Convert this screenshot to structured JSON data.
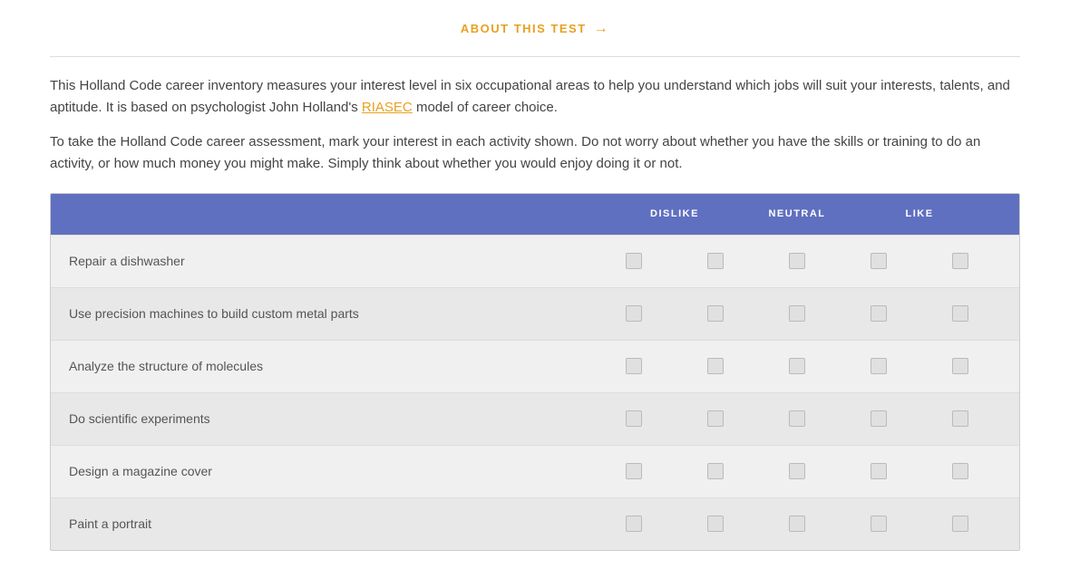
{
  "header": {
    "about_link": "ABOUT THIS TEST",
    "arrow": "→"
  },
  "intro": {
    "paragraph1": "This Holland Code career inventory measures your interest level in six occupational areas to help you understand which jobs will suit your interests, talents, and aptitude. It is based on psychologist John Holland's",
    "riasec_text": "RIASEC",
    "paragraph1_end": "model of career choice.",
    "paragraph2": "To take the Holland Code career assessment, mark your interest in each activity shown. Do not worry about whether you have the skills or training to do an activity, or how much money you might make. Simply think about whether you would enjoy doing it or not."
  },
  "table": {
    "columns": {
      "activity": "",
      "dislike_label": "DISLIKE",
      "neutral_label": "NEUTRAL",
      "like_label": "LIKE"
    },
    "activities": [
      {
        "id": 1,
        "label": "Repair a dishwasher"
      },
      {
        "id": 2,
        "label": "Use precision machines to build custom metal parts"
      },
      {
        "id": 3,
        "label": "Analyze the structure of molecules"
      },
      {
        "id": 4,
        "label": "Do scientific experiments"
      },
      {
        "id": 5,
        "label": "Design a magazine cover"
      },
      {
        "id": 6,
        "label": "Paint a portrait"
      }
    ]
  }
}
